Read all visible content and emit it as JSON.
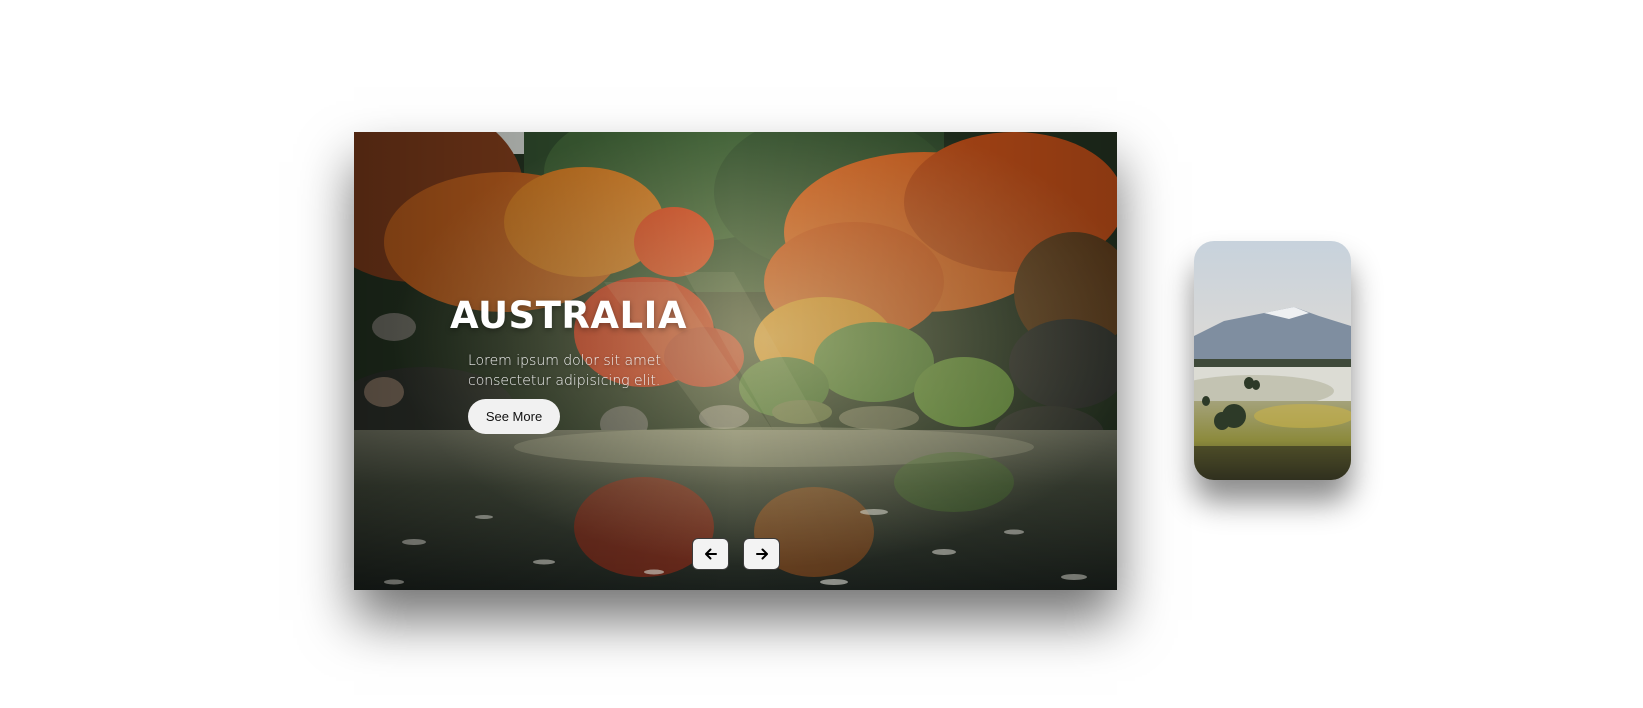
{
  "slider": {
    "current_slide": {
      "title": "AUSTRALIA",
      "description": "Lorem ipsum dolor sit amet consectetur adipisicing elit.",
      "cta_label": "See More",
      "image": "autumn-garden-pond-photo"
    },
    "controls": {
      "prev_icon": "arrow-left-icon",
      "next_icon": "arrow-right-icon"
    },
    "next_slide_preview": {
      "image": "misty-mountain-valley-photo"
    }
  },
  "colors": {
    "page_background": "#ffffff",
    "button_background": "#f1f1f1",
    "title_text": "#ffffff"
  }
}
